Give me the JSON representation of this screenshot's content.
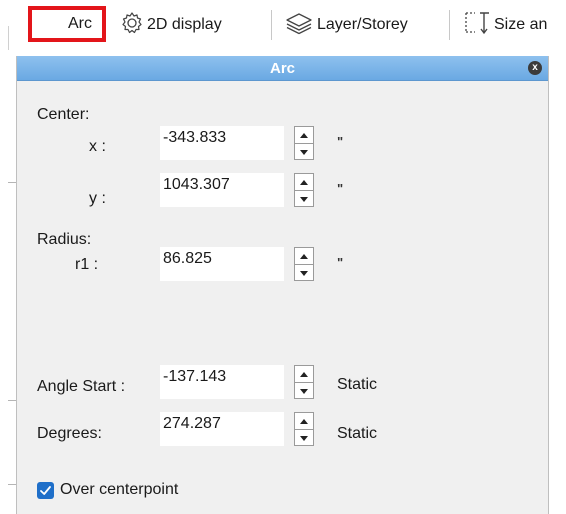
{
  "toolbar": {
    "arc_label": "Arc",
    "display_label": "2D display",
    "layer_label": "Layer/Storey",
    "size_label": "Size an"
  },
  "dialog": {
    "title": "Arc",
    "close_glyph": "x",
    "center_label": "Center:",
    "x_label": "x :",
    "x_value": "-343.833",
    "x_unit": "\"",
    "y_label": "y :",
    "y_value": "1043.307",
    "y_unit": "\"",
    "radius_label": "Radius:",
    "r1_label": "r1 :",
    "r1_value": "86.825",
    "r1_unit": "\"",
    "angle_start_label": "Angle Start :",
    "angle_start_value": "-137.143",
    "angle_start_mode": "Static",
    "degrees_label": "Degrees:",
    "degrees_value": "274.287",
    "degrees_mode": "Static",
    "over_centerpoint_label": "Over centerpoint",
    "over_centerpoint_checked": true
  },
  "colors": {
    "titlebar": "#7bb5e9",
    "highlight": "#e3151a",
    "checkbox": "#1f6fc9",
    "panel_bg": "#f0f0f0"
  },
  "icons": [
    "gear-icon",
    "layers-icon",
    "size-icon",
    "close-icon",
    "spin-up-icon",
    "spin-down-icon",
    "checkmark-icon"
  ]
}
